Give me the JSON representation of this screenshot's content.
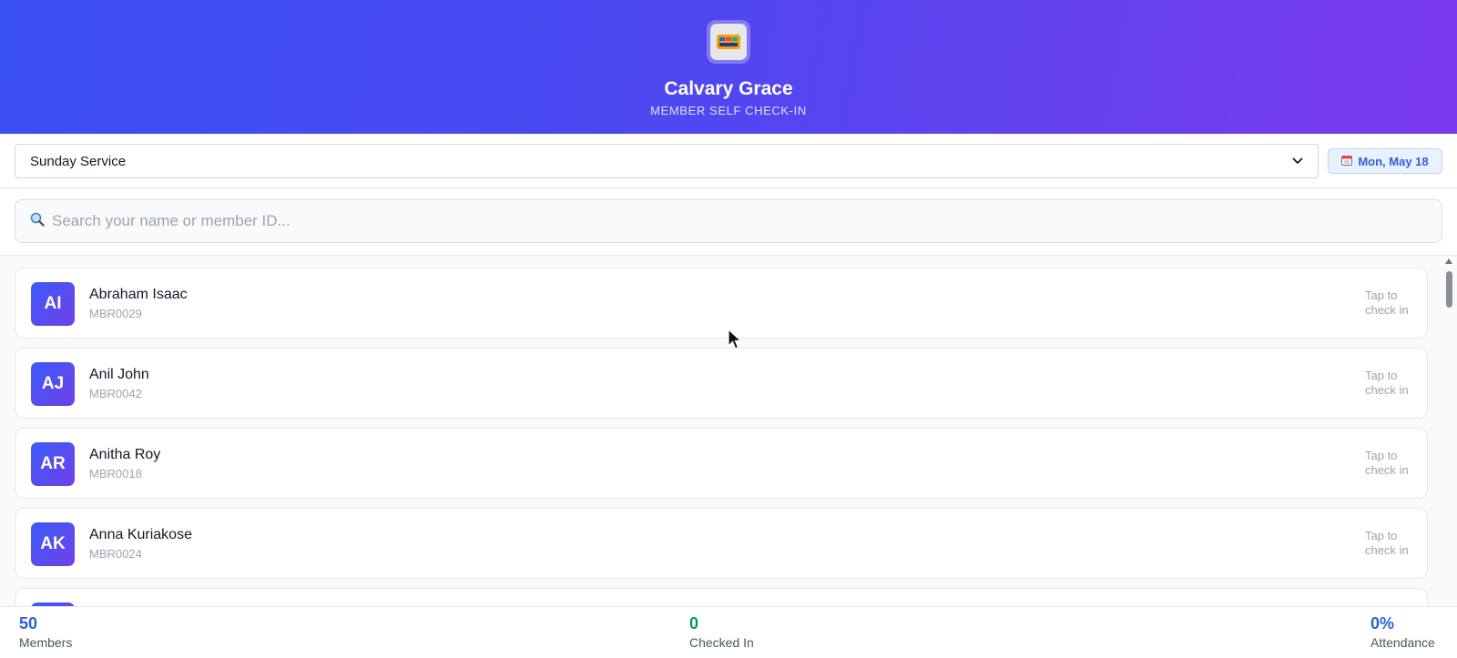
{
  "header": {
    "org_name": "Calvary Grace",
    "subtitle": "MEMBER SELF CHECK-IN",
    "logo_icon": "church-logo-icon"
  },
  "controls": {
    "service_selected": "Sunday Service",
    "date_label": "Mon, May 18"
  },
  "search": {
    "placeholder": "Search your name or member ID..."
  },
  "members": [
    {
      "initials": "AI",
      "name": "Abraham Isaac",
      "id": "MBR0029",
      "action": "Tap to check in"
    },
    {
      "initials": "AJ",
      "name": "Anil John",
      "id": "MBR0042",
      "action": "Tap to check in"
    },
    {
      "initials": "AR",
      "name": "Anitha Roy",
      "id": "MBR0018",
      "action": "Tap to check in"
    },
    {
      "initials": "AK",
      "name": "Anna Kuriakose",
      "id": "MBR0024",
      "action": "Tap to check in"
    }
  ],
  "stats": {
    "members_count": "50",
    "members_label": "Members",
    "checked_in_count": "0",
    "checked_in_label": "Checked In",
    "attendance_pct": "0%",
    "attendance_label": "Attendance"
  },
  "colors": {
    "accent_blue": "#2f5fe0",
    "checked_green": "#059669",
    "header_start": "#3b50f5",
    "header_end": "#7c3aed"
  }
}
